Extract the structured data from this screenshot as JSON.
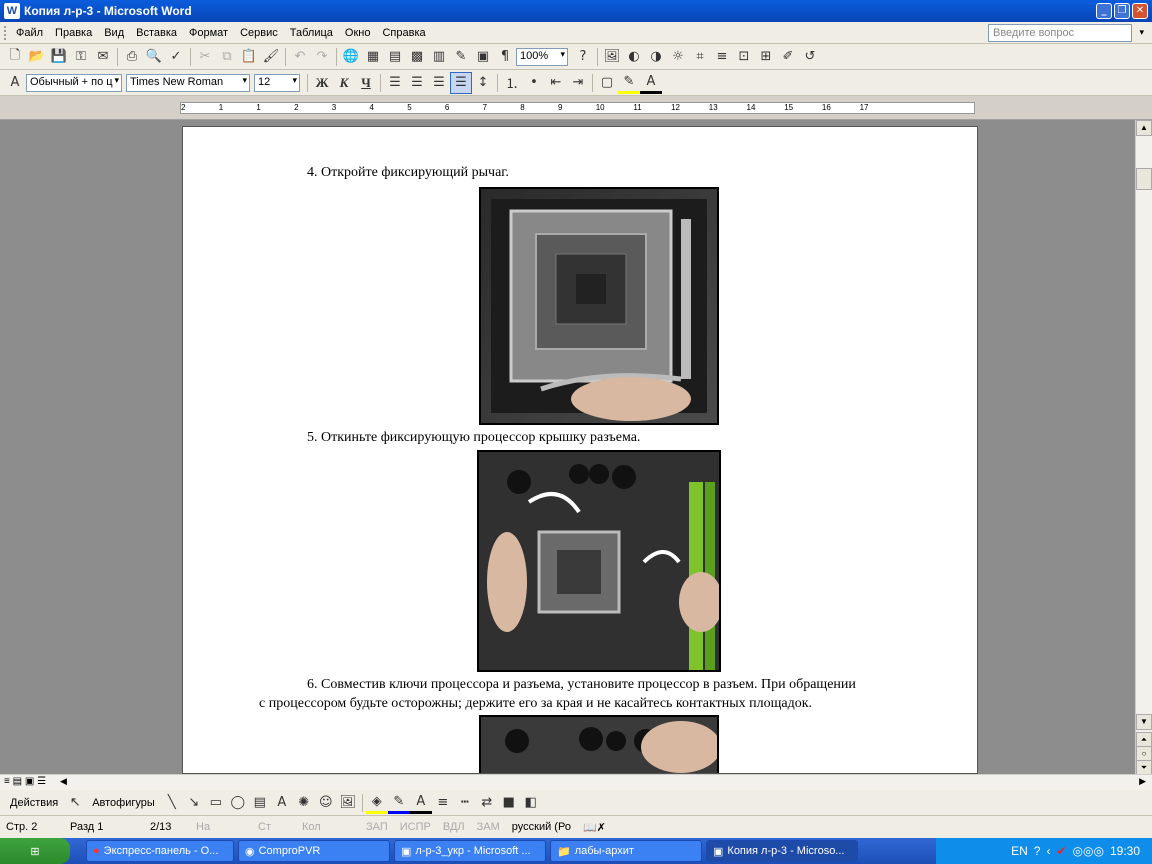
{
  "window": {
    "title": "Копия л-р-3 - Microsoft Word",
    "app_icon": "word-icon"
  },
  "menu": {
    "items": [
      "Файл",
      "Правка",
      "Вид",
      "Вставка",
      "Формат",
      "Сервис",
      "Таблица",
      "Окно",
      "Справка"
    ],
    "help_placeholder": "Введите вопрос"
  },
  "toolbar": {
    "zoom": "100%"
  },
  "formatting": {
    "style": "Обычный + по ц",
    "font": "Times New Roman",
    "size": "12",
    "bold": "Ж",
    "italic": "К",
    "underline": "Ч"
  },
  "ruler": {
    "ticks": [
      "2",
      "1",
      "1",
      "2",
      "3",
      "4",
      "5",
      "6",
      "7",
      "8",
      "9",
      "10",
      "11",
      "12",
      "13",
      "14",
      "15",
      "16",
      "17"
    ]
  },
  "document": {
    "step4": "4. Откройте фиксирующий рычаг.",
    "step5": "5. Откиньте фиксирующую процессор крышку разъема.",
    "step6_line1": "6. Совместив ключи процессора и разъема, установите процессор в разъем. При обращении",
    "step6_line2": "с процессором будьте осторожны; держите его за края и не касайтесь контактных площадок."
  },
  "drawing": {
    "actions": "Действия",
    "autoshapes": "Автофигуры"
  },
  "status": {
    "page": "Стр. 2",
    "section": "Разд 1",
    "pages": "2/13",
    "at": "На",
    "line": "Ст",
    "col": "Кол",
    "rec": "ЗАП",
    "trk": "ИСПР",
    "ext": "ВДЛ",
    "ovr": "ЗАМ",
    "lang": "русский (Ро"
  },
  "taskbar": {
    "tasks": [
      "Экспресс-панель - О...",
      "ComproPVR",
      "л-р-3_укр - Microsoft ...",
      "лабы-архит",
      "Копия л-р-3 - Microso..."
    ],
    "lang": "EN",
    "clock": "19:30"
  }
}
